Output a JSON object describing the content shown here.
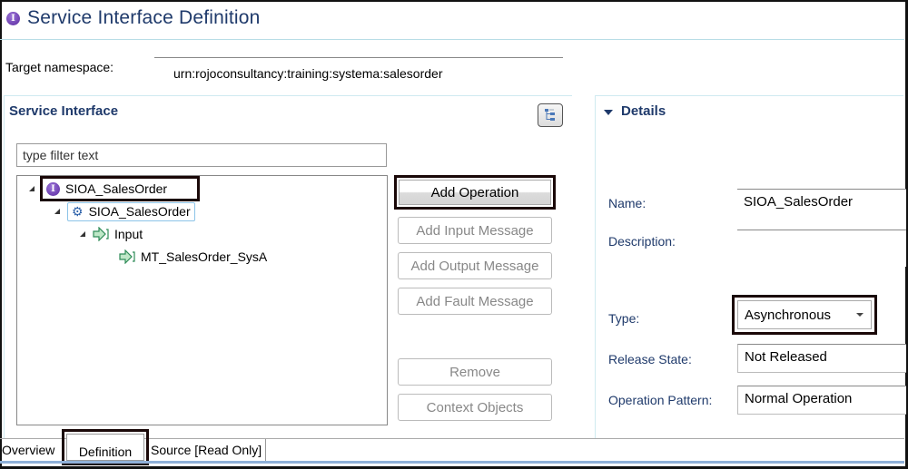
{
  "header": {
    "title": "Service Interface Definition",
    "title_icon": "service-interface-icon"
  },
  "namespace": {
    "label": "Target namespace:",
    "value": "urn:rojoconsultancy:training:systema:salesorder"
  },
  "service_interface": {
    "section_title": "Service Interface",
    "filter_placeholder": "type filter text",
    "tree": [
      {
        "label": "SIOA_SalesOrder",
        "icon": "service-interface-icon",
        "level": 0,
        "expanded": true,
        "highlighted": true
      },
      {
        "label": "SIOA_SalesOrder",
        "icon": "operation-gear-icon",
        "level": 1,
        "expanded": true,
        "selected": true
      },
      {
        "label": "Input",
        "icon": "message-arrow-icon",
        "level": 2,
        "expanded": true
      },
      {
        "label": "MT_SalesOrder_SysA",
        "icon": "message-arrow-icon",
        "level": 3
      }
    ]
  },
  "actions": {
    "add_operation": "Add Operation",
    "add_input_message": "Add Input Message",
    "add_output_message": "Add Output Message",
    "add_fault_message": "Add Fault Message",
    "remove": "Remove",
    "context_objects": "Context Objects"
  },
  "details": {
    "section_title": "Details",
    "name_label": "Name:",
    "name_value": "SIOA_SalesOrder",
    "description_label": "Description:",
    "description_value": "",
    "type_label": "Type:",
    "type_value": "Asynchronous",
    "release_state_label": "Release State:",
    "release_state_value": "Not Released",
    "operation_pattern_label": "Operation Pattern:",
    "operation_pattern_value": "Normal Operation"
  },
  "tabs": [
    {
      "label": "Overview",
      "active": false
    },
    {
      "label": "Definition",
      "active": true
    },
    {
      "label": "Source [Read Only]",
      "active": false
    }
  ],
  "colors": {
    "title": "#1f3a6b",
    "interface_icon": "#5a2a9e",
    "highlight_border": "#1a0808",
    "section_border": "#cfeaf0"
  }
}
